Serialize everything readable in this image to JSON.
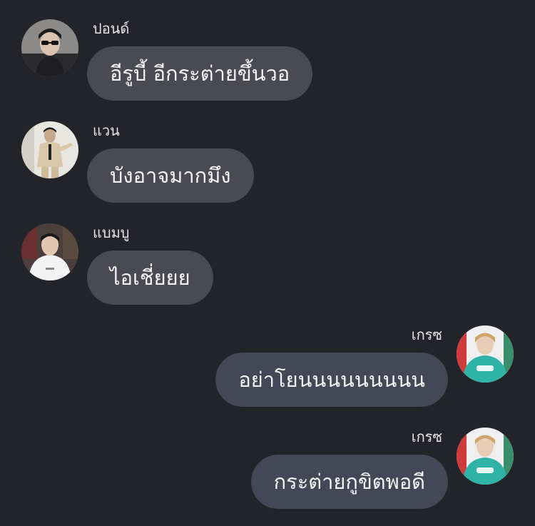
{
  "messages": [
    {
      "sender": "ปอนด์",
      "text": "อีรูบี้ อีกระต่ายขึ้นวอ",
      "side": "incoming",
      "avatar_icon": "user-avatar-sunglasses-icon"
    },
    {
      "sender": "แวน",
      "text": "บังอาจมากมึง",
      "side": "incoming",
      "avatar_icon": "user-avatar-suit-icon"
    },
    {
      "sender": "แบมบู",
      "text": "ไอเชี่ยยย",
      "side": "incoming",
      "avatar_icon": "user-avatar-hoodie-icon"
    },
    {
      "sender": "เกรซ",
      "text": "อย่าโยนนนนนนนนน",
      "side": "outgoing",
      "avatar_icon": "user-avatar-teal-sweater-icon"
    },
    {
      "sender": "เกรซ",
      "text": "กระต่ายกูขิตพอดี",
      "side": "outgoing",
      "avatar_icon": "user-avatar-teal-sweater-icon"
    }
  ],
  "colors": {
    "background": "#232429",
    "incoming_bubble": "#4a4b52",
    "outgoing_bubble": "#434756",
    "text": "#f4f4f6"
  }
}
